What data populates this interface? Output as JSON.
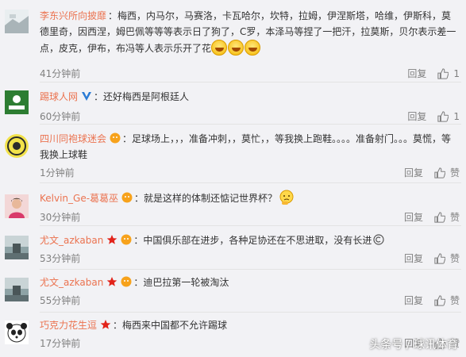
{
  "comments": [
    {
      "user": "李东兴所向披靡",
      "text": "：梅西，内马尔，马赛洛，卡瓦哈尔，坎特，拉姆，伊涅斯塔，哈维，伊斯科，莫德里奇，因西涅，姆巴佩等等等表示日了狗了，C罗，本泽马等捏了一把汗，拉莫斯，贝尔表示差一点，皮克，伊布，布冯等人表示乐开了花",
      "time": "41分钟前",
      "reply": "回复",
      "likes": "1"
    },
    {
      "user": "踢球人网",
      "text": "：还好梅西是阿根廷人",
      "time": "60分钟前",
      "reply": "回复",
      "likes": "1"
    },
    {
      "user": "四川同袍球迷会",
      "text": "：足球场上，，，准备冲刺，，莫忙，，等我换上跑鞋。。。。准备射门。。。莫慌，等我换上球鞋",
      "time": "1分钟前",
      "reply": "回复",
      "likes": "赞"
    },
    {
      "user": "Kelvin_Ge-葛葛巫",
      "text": "：就是这样的体制还惦记世界杯？",
      "time": "30分钟前",
      "reply": "回复",
      "likes": "赞"
    },
    {
      "user": "尤文_azkaban",
      "text": "：中国俱乐部在进步，各种足协还在不思进取，没有长进",
      "time": "53分钟前",
      "reply": "回复",
      "likes": "赞"
    },
    {
      "user": "尤文_azkaban",
      "text": "：迪巴拉第一轮被淘汰",
      "time": "55分钟前",
      "reply": "回复",
      "likes": "赞"
    },
    {
      "user": "巧克力花生逗",
      "text": "：梅西来中国都不允许踢球",
      "time": "17分钟前",
      "reply": "回复",
      "likes": "赞"
    }
  ],
  "watermark": "头条号 / 球讯体育",
  "colors": {
    "username": "#eb7350",
    "meta": "#808080",
    "background": "#f2f2f5"
  }
}
